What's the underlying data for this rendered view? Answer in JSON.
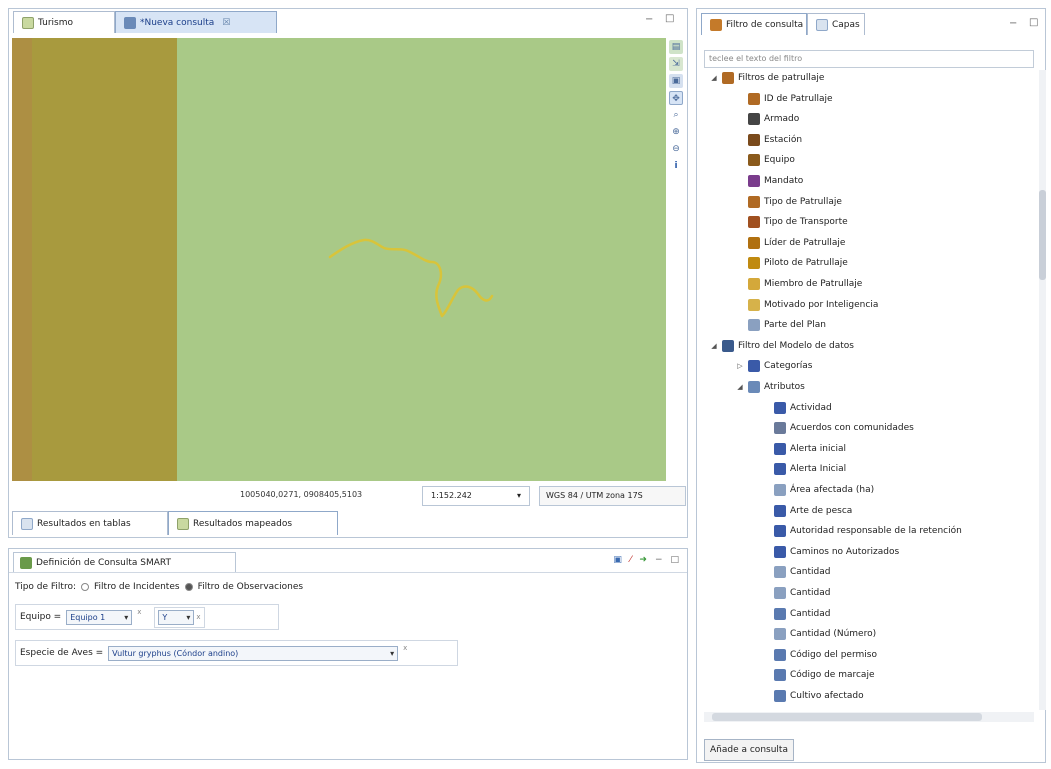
{
  "editor": {
    "tabs": [
      {
        "label": "Turismo",
        "icon": "map-icon",
        "active": false
      },
      {
        "label": "*Nueva consulta",
        "icon": "query-icon",
        "active": true,
        "close": "☒"
      }
    ],
    "window_controls": {
      "minimize": "−",
      "maximize": "□"
    },
    "map": {
      "colors": {
        "background": "#a9c987",
        "strip_brown": "#ad8f43",
        "strip_olive": "#a89a3e",
        "track": "#d8c43a"
      },
      "tool_icons": [
        "layers-icon",
        "export-icon",
        "print-icon",
        "pan-icon",
        "zoom-icon",
        "zoom-in-icon",
        "zoom-out-icon",
        "info-icon"
      ]
    },
    "status": {
      "coordinates": "1005040,0271, 0908405,5103",
      "scale": "1:152.242",
      "scale_arrow": "▾",
      "crs": "WGS 84 / UTM zona 17S"
    },
    "result_tabs": [
      {
        "label": "Resultados en tablas",
        "icon": "table-icon",
        "active": false
      },
      {
        "label": "Resultados mapeados",
        "icon": "map-results-icon",
        "active": true
      }
    ]
  },
  "query_def": {
    "title": "Definición de Consulta SMART",
    "filter_type_label": "Tipo de Filtro:",
    "filter_options": [
      {
        "label": "Filtro de Incidentes",
        "selected": false
      },
      {
        "label": "Filtro de Observaciones",
        "selected": true
      }
    ],
    "rows": [
      {
        "label": "Equipo =",
        "value": "Equipo 1",
        "sup": "x",
        "op": "Y",
        "op_sup": "x"
      },
      {
        "label": "Especie de Aves =",
        "value": "Vultur gryphus (Cóndor andino)",
        "sup": "x"
      }
    ]
  },
  "right_panel": {
    "tabs": [
      {
        "label": "Filtro de consulta",
        "active": true
      },
      {
        "label": "Capas",
        "active": false
      }
    ],
    "filter_placeholder": "teclee el texto del filtro",
    "tree": [
      {
        "label": "Filtros de patrullaje",
        "level": 0,
        "twisty": "◢",
        "icon": "patrol-icon",
        "color": "#b06a24"
      },
      {
        "label": "ID de Patrullaje",
        "level": 1,
        "icon": "patrol-id-icon",
        "color": "#b06a24"
      },
      {
        "label": "Armado",
        "level": 1,
        "icon": "armed-icon",
        "color": "#444444"
      },
      {
        "label": "Estación",
        "level": 1,
        "icon": "station-icon",
        "color": "#7a4a1c"
      },
      {
        "label": "Equipo",
        "level": 1,
        "icon": "team-icon",
        "color": "#8a5a1c"
      },
      {
        "label": "Mandato",
        "level": 1,
        "icon": "mandate-icon",
        "color": "#7a3c8c"
      },
      {
        "label": "Tipo de Patrullaje",
        "level": 1,
        "icon": "patrol-type-icon",
        "color": "#b06a24"
      },
      {
        "label": "Tipo de Transporte",
        "level": 1,
        "icon": "transport-icon",
        "color": "#a05020"
      },
      {
        "label": "Líder de Patrullaje",
        "level": 1,
        "icon": "leader-icon",
        "color": "#b07010"
      },
      {
        "label": "Piloto de Patrullaje",
        "level": 1,
        "icon": "pilot-icon",
        "color": "#c08a10"
      },
      {
        "label": "Miembro de Patrullaje",
        "level": 1,
        "icon": "member-icon",
        "color": "#d4a83a"
      },
      {
        "label": "Motivado por Inteligencia",
        "level": 1,
        "icon": "intelligence-icon",
        "color": "#d6b24a"
      },
      {
        "label": "Parte del Plan",
        "level": 1,
        "icon": "plan-icon",
        "color": "#8aa0c0"
      },
      {
        "label": "Filtro del Modelo de datos",
        "level": 0,
        "twisty": "◢",
        "icon": "data-model-icon",
        "color": "#3a5a8c"
      },
      {
        "label": "Categorías",
        "level": 1,
        "twisty": "▷",
        "icon": "categories-icon",
        "color": "#3a5aa8"
      },
      {
        "label": "Atributos",
        "level": 1,
        "twisty": "◢",
        "icon": "attributes-icon",
        "color": "#6a8ab8"
      },
      {
        "label": "Actividad",
        "level": 2,
        "icon": "list-icon",
        "color": "#3a5aa8"
      },
      {
        "label": "Acuerdos con comunidades",
        "level": 2,
        "icon": "tree-attr-icon",
        "color": "#6a7a9a"
      },
      {
        "label": "Alerta inicial",
        "level": 2,
        "icon": "list-icon",
        "color": "#3a5aa8"
      },
      {
        "label": "Alerta Inicial",
        "level": 2,
        "icon": "list-icon",
        "color": "#3a5aa8"
      },
      {
        "label": "Área afectada (ha)",
        "level": 2,
        "icon": "numeric-icon",
        "color": "#8aa0c0"
      },
      {
        "label": "Arte de pesca",
        "level": 2,
        "icon": "list-icon",
        "color": "#3a5aa8"
      },
      {
        "label": "Autoridad responsable de la retención",
        "level": 2,
        "icon": "list-icon",
        "color": "#3a5aa8"
      },
      {
        "label": "Caminos no Autorizados",
        "level": 2,
        "icon": "list-icon",
        "color": "#3a5aa8"
      },
      {
        "label": "Cantidad",
        "level": 2,
        "icon": "numeric-icon",
        "color": "#8aa0c0"
      },
      {
        "label": "Cantidad",
        "level": 2,
        "icon": "numeric-icon",
        "color": "#8aa0c0"
      },
      {
        "label": "Cantidad",
        "level": 2,
        "icon": "text-attr-icon",
        "color": "#5a7ab0"
      },
      {
        "label": "Cantidad (Número)",
        "level": 2,
        "icon": "numeric-icon",
        "color": "#8aa0c0"
      },
      {
        "label": "Código del permiso",
        "level": 2,
        "icon": "text-attr-icon",
        "color": "#5a7ab0"
      },
      {
        "label": "Código de marcaje",
        "level": 2,
        "icon": "text-attr-icon",
        "color": "#5a7ab0"
      },
      {
        "label": "Cultivo afectado",
        "level": 2,
        "icon": "text-attr-icon",
        "color": "#5a7ab0"
      }
    ],
    "add_button": "Añade a consulta"
  }
}
